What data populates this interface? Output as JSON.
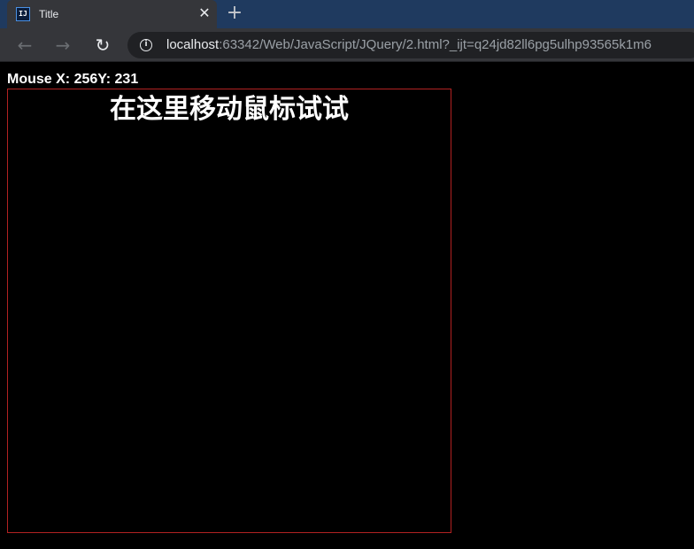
{
  "browser": {
    "tab": {
      "favicon_text": "IJ",
      "title": "Title",
      "close_glyph": "✕"
    },
    "new_tab_glyph": "+",
    "nav": {
      "back_glyph": "←",
      "forward_glyph": "→",
      "reload_glyph": "↻"
    },
    "address": {
      "info_glyph": "i",
      "host": "localhost",
      "rest": ":63342/Web/JavaScript/JQuery/2.html?_ijt=q24jd82ll6pg5ulhp93565k1m6"
    }
  },
  "page": {
    "mouse_readout": "Mouse X: 256Y: 231",
    "heading": "在这里移动鼠标试试",
    "colors": {
      "background": "#000000",
      "text": "#ffffff",
      "area_border": "#b22222"
    }
  }
}
